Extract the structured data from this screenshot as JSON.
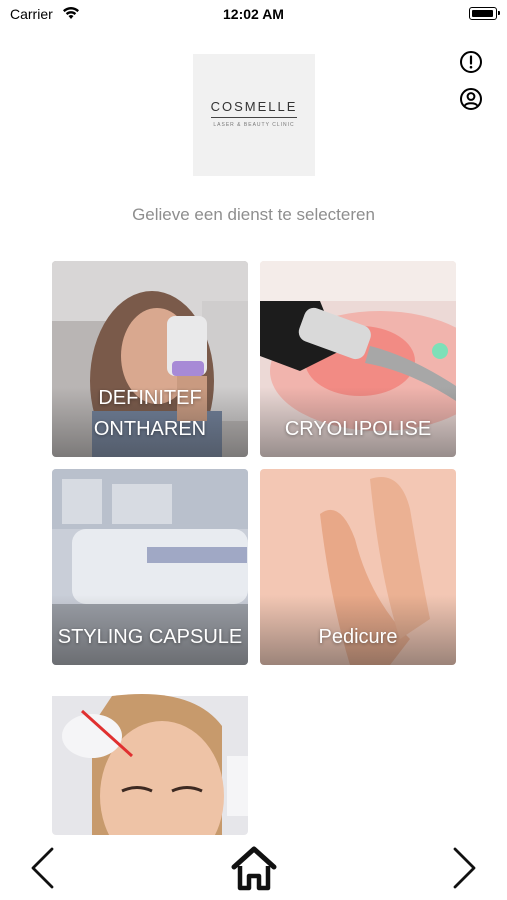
{
  "status_bar": {
    "carrier": "Carrier",
    "time": "12:02 AM"
  },
  "logo": {
    "brand": "COSMELLE",
    "tagline": "LASER & BEAUTY CLINIC"
  },
  "header": {
    "alert_icon": "alert-circle-icon",
    "user_icon": "user-circle-icon"
  },
  "subtitle": "Gelieve een dienst te selecteren",
  "services": [
    {
      "label": "DEFINITEF ONTHAREN"
    },
    {
      "label": "CRYOLIPOLISE"
    },
    {
      "label": "STYLING CAPSULE"
    },
    {
      "label": "Pedicure"
    },
    {
      "label": ""
    }
  ],
  "nav": {
    "back_icon": "chevron-left-icon",
    "home_icon": "home-icon",
    "forward_icon": "chevron-right-icon"
  }
}
